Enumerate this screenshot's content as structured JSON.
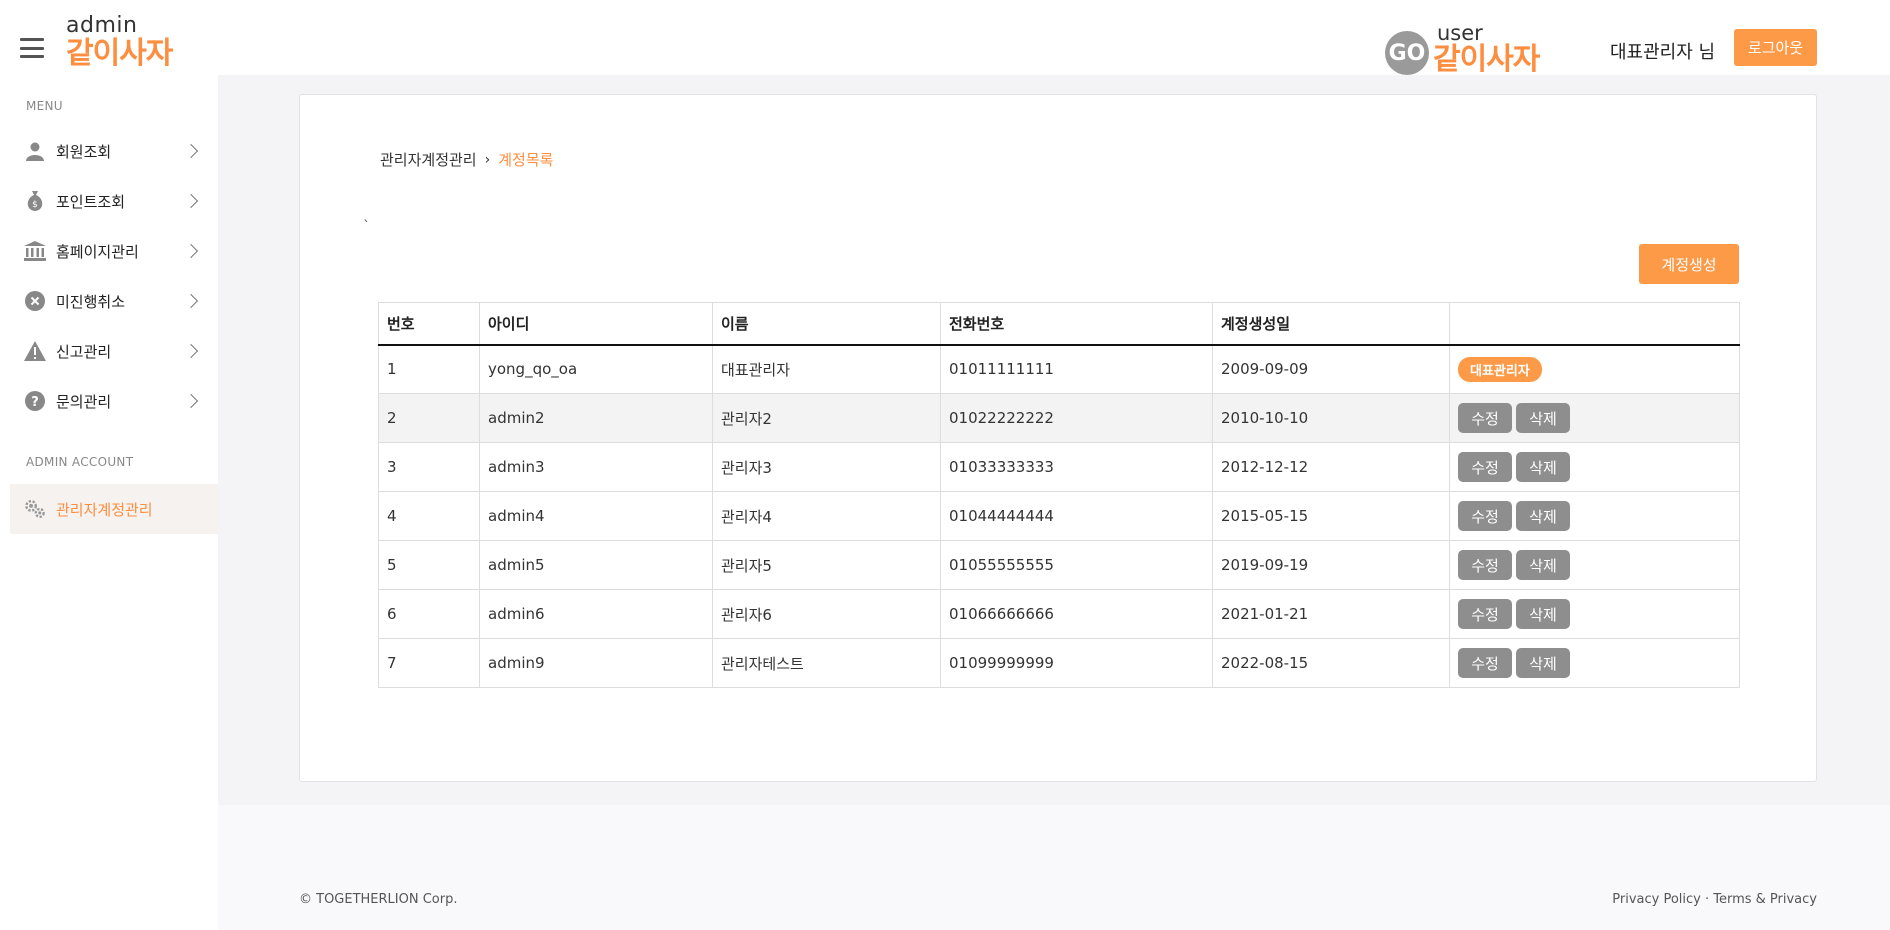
{
  "header": {
    "brand_sub": "admin",
    "brand_main": "같이사자",
    "user_brand_go": "GO",
    "user_brand_sub": "user",
    "user_brand_main": "같이사자",
    "admin_name": "대표관리자 님",
    "logout_label": "로그아웃"
  },
  "sidebar": {
    "menu_label": "MENU",
    "items": [
      {
        "label": "회원조회",
        "icon": "person-icon"
      },
      {
        "label": "포인트조회",
        "icon": "money-bag-icon"
      },
      {
        "label": "홈페이지관리",
        "icon": "bank-icon"
      },
      {
        "label": "미진행취소",
        "icon": "cancel-circle-icon"
      },
      {
        "label": "신고관리",
        "icon": "warning-icon"
      },
      {
        "label": "문의관리",
        "icon": "question-circle-icon"
      }
    ],
    "admin_label": "ADMIN ACCOUNT",
    "admin_item": {
      "label": "관리자계정관리",
      "icon": "gears-icon"
    }
  },
  "breadcrumb": {
    "parent": "관리자계정관리",
    "separator": "›",
    "current": "계정목록"
  },
  "stray_mark": "`",
  "create_button": "계정생성",
  "table": {
    "headers": [
      "번호",
      "아이디",
      "이름",
      "전화번호",
      "계정생성일",
      ""
    ],
    "rows": [
      {
        "no": "1",
        "id": "yong_qo_oa",
        "name": "대표관리자",
        "phone": "01011111111",
        "created": "2009-09-09",
        "badge": "대표관리자"
      },
      {
        "no": "2",
        "id": "admin2",
        "name": "관리자2",
        "phone": "01022222222",
        "created": "2010-10-10"
      },
      {
        "no": "3",
        "id": "admin3",
        "name": "관리자3",
        "phone": "01033333333",
        "created": "2012-12-12"
      },
      {
        "no": "4",
        "id": "admin4",
        "name": "관리자4",
        "phone": "01044444444",
        "created": "2015-05-15"
      },
      {
        "no": "5",
        "id": "admin5",
        "name": "관리자5",
        "phone": "01055555555",
        "created": "2019-09-19"
      },
      {
        "no": "6",
        "id": "admin6",
        "name": "관리자6",
        "phone": "01066666666",
        "created": "2021-01-21"
      },
      {
        "no": "7",
        "id": "admin9",
        "name": "관리자테스트",
        "phone": "01099999999",
        "created": "2022-08-15"
      }
    ],
    "edit_label": "수정",
    "delete_label": "삭제"
  },
  "footer": {
    "copyright": "© TOGETHERLION Corp.",
    "links": "Privacy Policy · Terms & Privacy"
  },
  "colors": {
    "accent": "#fd8e3f",
    "button_gray": "#8e8e8e",
    "main_bg": "#f4f4f7"
  }
}
